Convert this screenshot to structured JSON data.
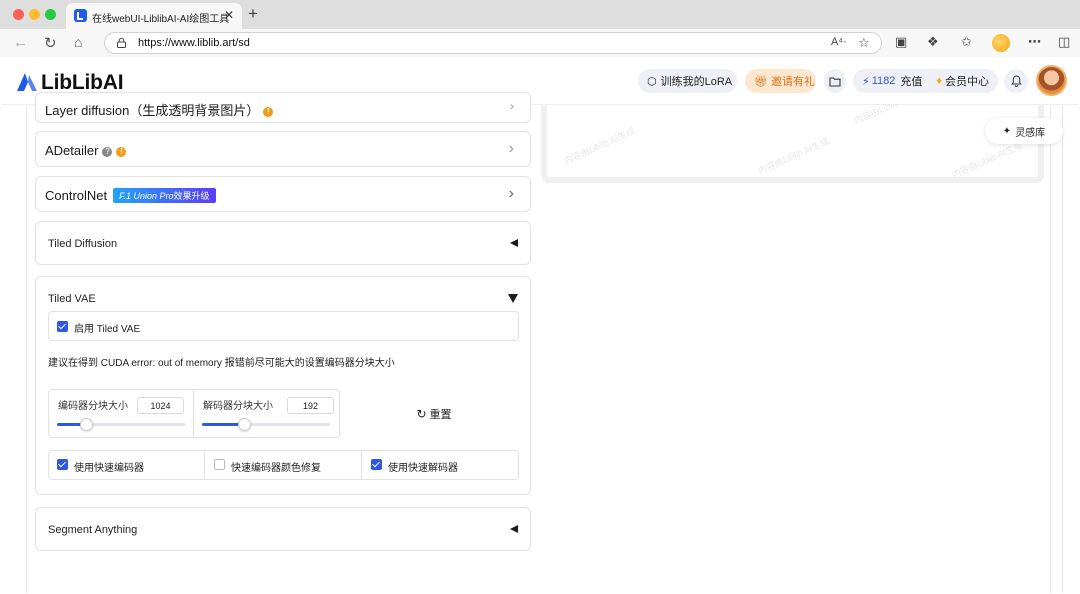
{
  "browser": {
    "tab_title": "在线webUI-LiblibAI-AI绘图工具",
    "url": "https://www.liblib.art/sd",
    "reader_icon_label": "A⁴·",
    "new_tab_symbol": "+",
    "close_symbol": "✕"
  },
  "header": {
    "logo_text": "LibLibAI",
    "train_lora_label": "训练我的LoRA",
    "invite_label": "邀请有礼",
    "credits_count": "1182",
    "recharge_label": "充值",
    "member_center_label": "会员中心"
  },
  "panels": {
    "layer_diffusion_title": "Layer diffusion（生成透明背景图片）",
    "adetailer_title": "ADetailer",
    "controlnet_title": "ControlNet",
    "controlnet_badge_prefix": "F.1 Union Pro",
    "controlnet_badge_suffix": "效果升级",
    "tiled_diffusion_title": "Tiled Diffusion",
    "tiled_vae_title": "Tiled VAE",
    "segment_anything_title": "Segment Anything"
  },
  "tiled_vae": {
    "enable_label": "启用 Tiled VAE",
    "enable_checked": true,
    "memory_note": "建议在得到 CUDA error: out of memory 报错前尽可能大的设置编码器分块大小",
    "encoder_tile_label": "编码器分块大小",
    "encoder_tile_value": "1024",
    "encoder_tile_fraction": 0.23,
    "decoder_tile_label": "解码器分块大小",
    "decoder_tile_value": "192",
    "decoder_tile_fraction": 0.33,
    "reset_label": "重置",
    "fast_encoder_label": "使用快速编码器",
    "fast_encoder_checked": true,
    "fast_encoder_color_fix_label": "快速编码器颜色修复",
    "fast_encoder_color_fix_checked": false,
    "fast_decoder_label": "使用快速解码器",
    "fast_decoder_checked": true
  },
  "preview": {
    "watermark_text": "内容由Liblib AI生成"
  },
  "inspiration_label": "灵感库",
  "colors": {
    "accent_blue": "#2f57e6",
    "invite_orange": "#d7711b",
    "warning_orange": "#f39c12"
  }
}
